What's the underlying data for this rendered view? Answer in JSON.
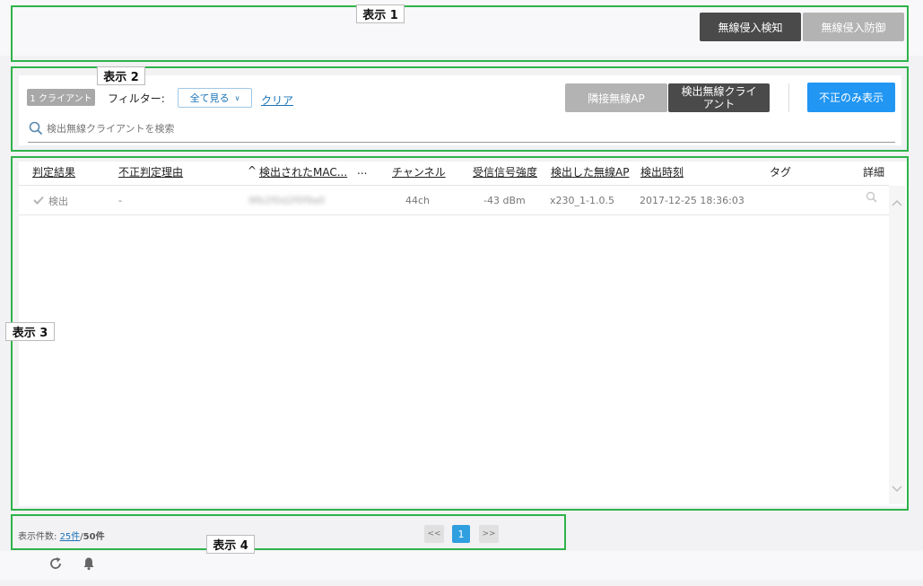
{
  "header": {
    "detect_button": "無線侵入検知",
    "protect_button": "無線侵入防御"
  },
  "toolbar": {
    "client_count": "1 クライアント",
    "filter_label": "フィルター:",
    "filter_value": "全て見る",
    "clear_link": "クリア",
    "tab_adjacent": "隣接無線AP",
    "tab_detected_line1": "検出無線クライ",
    "tab_detected_line2": "アント",
    "rogue_only_button": "不正のみ表示",
    "search_placeholder": "検出無線クライアントを検索"
  },
  "table": {
    "columns": [
      "判定結果",
      "不正判定理由",
      "検出されたMAC...",
      "...",
      "チャンネル",
      "受信信号強度",
      "検出した無線AP",
      "検出時刻",
      "タグ",
      "詳細"
    ],
    "sort_indicator": "^",
    "rows": [
      {
        "result": "検出",
        "reason": "-",
        "mac": "9fb2f0d2f0f9a0",
        "channel": "44ch",
        "rssi": "-43 dBm",
        "ap": "x230_1-1.0.5",
        "time": "2017-12-25 18:36:03"
      }
    ]
  },
  "footer": {
    "count_label": "表示件数:",
    "per_page": "25件",
    "separator": "/",
    "total": "50件",
    "prev": "<<",
    "page": "1",
    "next": ">>"
  },
  "annotations": {
    "label1": "表示 1",
    "label2": "表示 2",
    "label3": "表示 3",
    "label4": "表示 4"
  },
  "colors": {
    "annotation_green": "#2eb34a",
    "accent_blue": "#2196f3",
    "dark_button": "#4a4a4a"
  }
}
